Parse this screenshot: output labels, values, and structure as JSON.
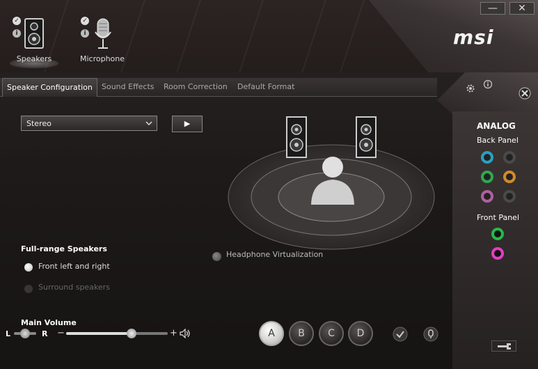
{
  "window": {
    "minimize_glyph": "—",
    "close_glyph": "✕",
    "logo": "msi"
  },
  "devices": [
    {
      "label": "Speakers",
      "icon": "speaker-icon",
      "selected": true
    },
    {
      "label": "Microphone",
      "icon": "microphone-icon",
      "selected": false
    }
  ],
  "tabs": [
    {
      "label": "Speaker Configuration",
      "active": true
    },
    {
      "label": "Sound Effects",
      "active": false
    },
    {
      "label": "Room Correction",
      "active": false
    },
    {
      "label": "Default Format",
      "active": false
    }
  ],
  "config": {
    "select_value": "Stereo",
    "play_glyph": "▶"
  },
  "full_range": {
    "title": "Full-range Speakers",
    "options": [
      {
        "label": "Front left and right",
        "checked": true,
        "enabled": true
      },
      {
        "label": "Surround speakers",
        "checked": false,
        "enabled": false
      }
    ]
  },
  "headphone_virtualization": {
    "label": "Headphone Virtualization",
    "checked": false
  },
  "volume": {
    "label": "Main Volume",
    "left": "L",
    "right": "R",
    "minus": "−",
    "plus": "+",
    "level_percent": 66
  },
  "profiles": [
    {
      "label": "A",
      "selected": true
    },
    {
      "label": "B",
      "selected": false
    },
    {
      "label": "C",
      "selected": false
    },
    {
      "label": "D",
      "selected": false
    }
  ],
  "analog": {
    "title": "ANALOG",
    "back_panel": "Back Panel",
    "front_panel": "Front Panel"
  },
  "colors": {
    "jack_blue": "#2a9fc3",
    "jack_grey": "#555555",
    "jack_green": "#2fa84f",
    "jack_orange": "#d48a2a",
    "jack_pink": "#d050b0",
    "front_green": "#27b84a",
    "front_pink": "#e040c0"
  }
}
